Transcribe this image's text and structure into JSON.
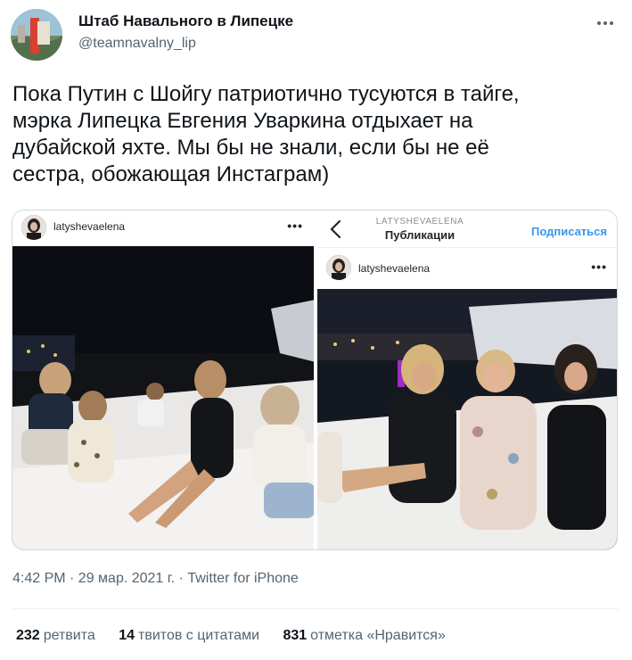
{
  "author": {
    "display_name": "Штаб Навального в Липецке",
    "handle": "@teamnavalny_lip"
  },
  "tweet": {
    "lines": [
      "Пока Путин с Шойгу патриотично тусуются в тайге,",
      "мэрка Липецка Евгения Уваркина отдыхает на",
      "дубайской яхте. Мы бы не знали, если бы не её",
      "сестра, обожающая Инстаграм)"
    ]
  },
  "media": {
    "left": {
      "username": "latyshevaelena",
      "dots": "•••"
    },
    "right": {
      "nav_subtitle": "LATYSHEVAELENA",
      "nav_title": "Публикации",
      "follow_label": "Подписаться",
      "username": "latyshevaelena",
      "dots": "•••"
    }
  },
  "meta": {
    "timestamp": "4:42 PM · 29 мар. 2021 г. · Twitter for iPhone"
  },
  "stats": {
    "retweets_count": "232",
    "retweets_label": "ретвита",
    "quotes_count": "14",
    "quotes_label": "твитов с цитатами",
    "likes_count": "831",
    "likes_label": "отметка «Нравится»"
  },
  "colors": {
    "text_primary": "#0f1419",
    "text_secondary": "#536471",
    "border": "#cfd9de",
    "instagram_link": "#3897f0"
  }
}
